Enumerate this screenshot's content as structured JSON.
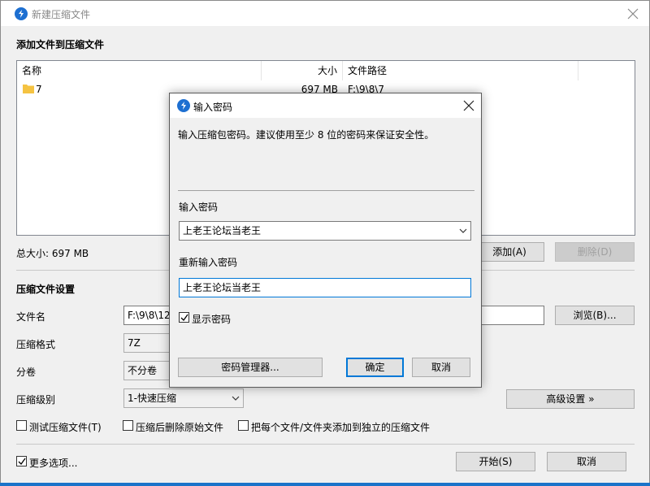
{
  "main": {
    "title": "新建压缩文件",
    "section_add": "添加文件到压缩文件",
    "columns": {
      "name": "名称",
      "size": "大小",
      "path": "文件路径"
    },
    "files": [
      {
        "name": "7",
        "size": "697 MB",
        "path": "F:\\9\\8\\7"
      }
    ],
    "total_size": "总大小: 697 MB",
    "add_button": "添加(A)",
    "delete_button": "删除(D)",
    "section_settings": "压缩文件设置",
    "filename_label": "文件名",
    "filename_value": "F:\\9\\8\\12",
    "browse_button": "浏览(B)...",
    "format_label": "压缩格式",
    "format_value": "7Z",
    "split_label": "分卷",
    "split_value": "不分卷",
    "level_label": "压缩级别",
    "level_value": "1-快速压缩",
    "advanced_button": "高级设置 »",
    "options": {
      "test": "测试压缩文件(T)",
      "delete_after": "压缩后删除原始文件",
      "each_separate": "把每个文件/文件夹添加到独立的压缩文件"
    },
    "more_options": "更多选项...",
    "start_button": "开始(S)",
    "cancel_button": "取消"
  },
  "dialog": {
    "title": "输入密码",
    "description": "输入压缩包密码。建议使用至少 8 位的密码来保证安全性。",
    "password_label": "输入密码",
    "password_value": "上老王论坛当老王",
    "confirm_label": "重新输入密码",
    "confirm_value": "上老王论坛当老王",
    "show_password": "显示密码",
    "show_password_checked": true,
    "manager_button": "密码管理器...",
    "ok_button": "确定",
    "cancel_button": "取消"
  },
  "colors": {
    "accent": "#0078d7",
    "app_icon": "#1d6fd1",
    "folder": "#f5c342",
    "taskbar": "#1a73c9"
  }
}
